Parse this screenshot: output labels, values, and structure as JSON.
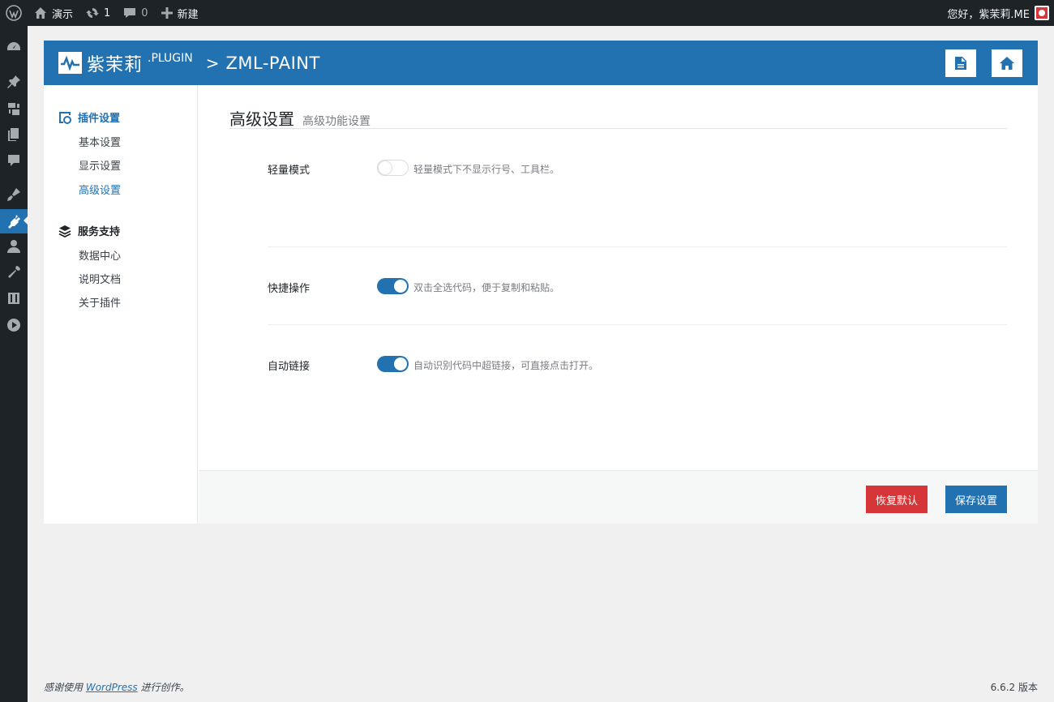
{
  "adminbar": {
    "site_name": "演示",
    "updates_count": "1",
    "comments_count": "0",
    "new_label": "新建",
    "greeting": "您好，紫茉莉.ME"
  },
  "admin_menu": {
    "icons": [
      "dashboard-icon",
      "pin-icon",
      "media-icon",
      "pages-icon",
      "comments-icon",
      "appearance-icon",
      "plugins-icon",
      "users-icon",
      "tools-icon",
      "settings-icon",
      "play-icon"
    ],
    "current": "plugins-icon"
  },
  "plugin_header": {
    "brand_name": "紫茉莉",
    "brand_suffix": ".PLUGIN",
    "separator": ">",
    "title": "ZML-PAINT"
  },
  "nav": {
    "group1": {
      "title": "插件设置",
      "items": [
        "基本设置",
        "显示设置",
        "高级设置"
      ],
      "active": "高级设置"
    },
    "group2": {
      "title": "服务支持",
      "items": [
        "数据中心",
        "说明文档",
        "关于插件"
      ]
    }
  },
  "section": {
    "title": "高级设置",
    "subtitle": "高级功能设置",
    "rows": [
      {
        "label": "轻量模式",
        "enabled": false,
        "desc": "轻量模式下不显示行号、工具栏。"
      },
      {
        "label": "快捷操作",
        "enabled": true,
        "desc": "双击全选代码，便于复制和粘贴。"
      },
      {
        "label": "自动链接",
        "enabled": true,
        "desc": "自动识别代码中超链接，可直接点击打开。"
      }
    ]
  },
  "actions": {
    "reset_label": "恢复默认",
    "save_label": "保存设置"
  },
  "colors": {
    "primary": "#2271b1",
    "danger": "#d63638",
    "adminbar": "#1d2327"
  },
  "footer": {
    "thanks_prefix": "感谢使用",
    "thanks_link": "WordPress",
    "thanks_suffix": "进行创作。",
    "version": "6.6.2 版本"
  }
}
